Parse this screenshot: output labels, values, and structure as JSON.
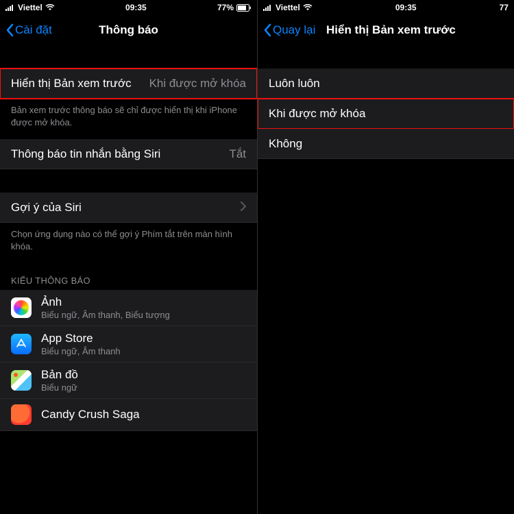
{
  "status": {
    "carrier": "Viettel",
    "time": "09:35",
    "battery": "77%",
    "battery_right_trim": "77"
  },
  "left": {
    "back": "Cài đặt",
    "title": "Thông báo",
    "preview_label": "Hiển thị Bản xem trước",
    "preview_value": "Khi được mở khóa",
    "preview_footer": "Bản xem trước thông báo sẽ chỉ được hiển thị khi iPhone được mở khóa.",
    "siri_announce_label": "Thông báo tin nhắn bằng Siri",
    "siri_announce_value": "Tắt",
    "siri_suggest_label": "Gợi ý của Siri",
    "siri_suggest_footer": "Chọn ứng dụng nào có thể gợi ý Phím tắt trên màn hình khóa.",
    "style_header": "KIỂU THÔNG BÁO",
    "apps": [
      {
        "name": "Ảnh",
        "sub": "Biểu ngữ, Âm thanh, Biểu tượng",
        "icon": "photos"
      },
      {
        "name": "App Store",
        "sub": "Biểu ngữ, Âm thanh",
        "icon": "appstore"
      },
      {
        "name": "Bản đồ",
        "sub": "Biểu ngữ",
        "icon": "maps"
      },
      {
        "name": "Candy Crush Saga",
        "sub": "",
        "icon": "candy"
      }
    ]
  },
  "right": {
    "back": "Quay lại",
    "title": "Hiển thị Bản xem trước",
    "options": [
      "Luôn luôn",
      "Khi được mở khóa",
      "Không"
    ],
    "selected_index": 1
  }
}
